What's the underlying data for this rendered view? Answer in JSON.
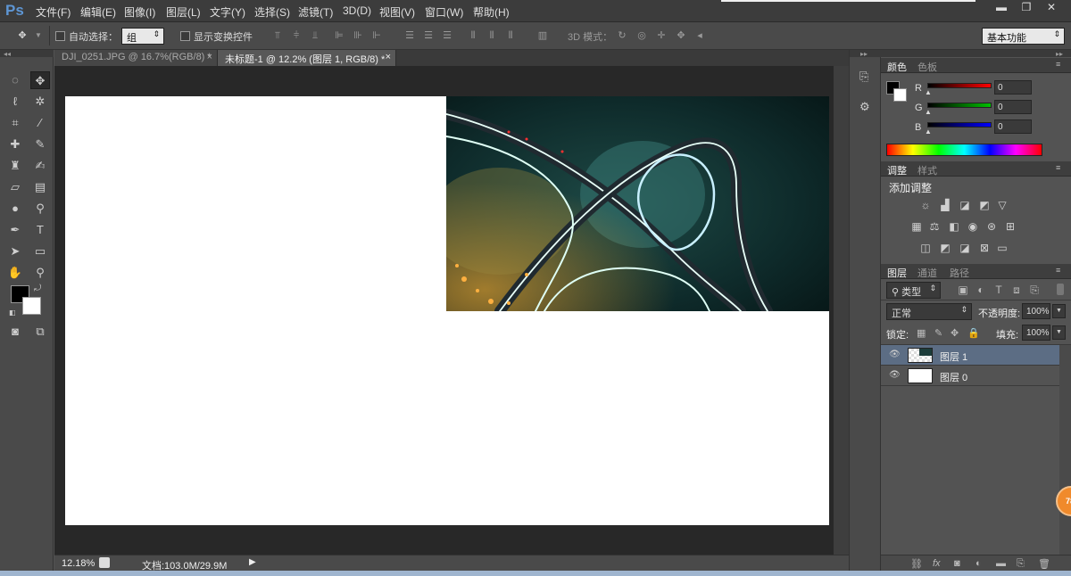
{
  "app": {
    "logo": "Ps"
  },
  "menu": [
    "文件(F)",
    "编辑(E)",
    "图像(I)",
    "图层(L)",
    "文字(Y)",
    "选择(S)",
    "滤镜(T)",
    "3D(D)",
    "视图(V)",
    "窗口(W)",
    "帮助(H)"
  ],
  "window_controls": {
    "minimize": "▬",
    "restore": "❐",
    "close": "✕"
  },
  "options": {
    "auto_select_label": "自动选择：",
    "auto_select_value": "组",
    "show_transform_label": "显示变换控件",
    "mode_3d_label": "3D 模式：",
    "workspace_value": "基本功能"
  },
  "tabs": [
    {
      "label": "DJI_0251.JPG @ 16.7%(RGB/8) *",
      "close": "×"
    },
    {
      "label": "未标题-1 @ 12.2% (图层 1, RGB/8) *",
      "close": "×"
    }
  ],
  "status": {
    "zoom": "12.18%",
    "doc": "文档:103.0M/29.9M"
  },
  "color_panel": {
    "tabs": [
      "颜色",
      "色板"
    ],
    "channels": [
      {
        "label": "R",
        "value": "0",
        "color": "#ff0000"
      },
      {
        "label": "G",
        "value": "0",
        "color": "#00c000"
      },
      {
        "label": "B",
        "value": "0",
        "color": "#0000ff"
      }
    ]
  },
  "adjust_panel": {
    "tabs": [
      "调整",
      "样式"
    ],
    "title": "添加调整",
    "icons": [
      "brightness-icon",
      "levels-icon",
      "curves-icon",
      "exposure-icon",
      "vibrance-icon",
      "hue-saturation-icon",
      "color-balance-icon",
      "black-white-icon",
      "photo-filter-icon",
      "channel-mixer-icon",
      "color-lookup-icon",
      "invert-icon",
      "posterize-icon",
      "threshold-icon",
      "selective-color-icon",
      "gradient-map-icon"
    ]
  },
  "layers_panel": {
    "tabs": [
      "图层",
      "通道",
      "路径"
    ],
    "filter_value": "类型",
    "blend_mode": "正常",
    "opacity_label": "不透明度:",
    "opacity_value": "100%",
    "lock_label": "锁定:",
    "fill_label": "填充:",
    "fill_value": "100%",
    "layers": [
      {
        "name": "图层 1",
        "selected": true
      },
      {
        "name": "图层 0",
        "selected": false
      }
    ]
  },
  "badge": {
    "text": "78"
  }
}
